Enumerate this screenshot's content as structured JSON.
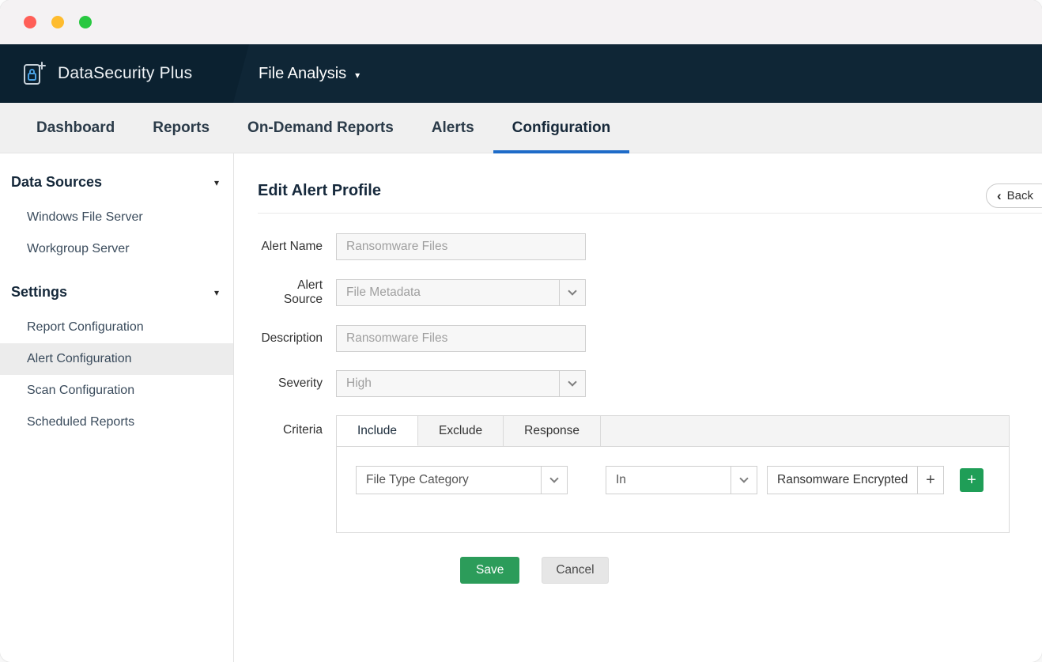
{
  "colors": {
    "header_navy": "#0f2636",
    "accent_blue": "#1e6bc8",
    "action_green": "#2c9c5a",
    "add_green": "#1f9e57",
    "nav_bg": "#f0f0f0",
    "active_item_bg": "#ececec"
  },
  "icons": {
    "module_caret": "▾",
    "section_caret": "▾",
    "back_chevron": "‹",
    "plus": "+"
  },
  "header": {
    "app_name": "DataSecurity Plus",
    "module": "File Analysis"
  },
  "nav": {
    "items": [
      {
        "label": "Dashboard",
        "active": false
      },
      {
        "label": "Reports",
        "active": false
      },
      {
        "label": "On-Demand Reports",
        "active": false
      },
      {
        "label": "Alerts",
        "active": false
      },
      {
        "label": "Configuration",
        "active": true
      }
    ]
  },
  "sidebar": {
    "sections": [
      {
        "title": "Data Sources",
        "items": [
          {
            "label": "Windows File Server",
            "active": false
          },
          {
            "label": "Workgroup Server",
            "active": false
          }
        ]
      },
      {
        "title": "Settings",
        "items": [
          {
            "label": "Report Configuration",
            "active": false
          },
          {
            "label": "Alert Configuration",
            "active": true
          },
          {
            "label": "Scan Configuration",
            "active": false
          },
          {
            "label": "Scheduled Reports",
            "active": false
          }
        ]
      }
    ]
  },
  "main": {
    "title": "Edit Alert Profile",
    "back_label": "Back",
    "form": {
      "alert_name": {
        "label": "Alert Name",
        "value": "Ransomware Files"
      },
      "alert_source": {
        "label": "Alert Source",
        "value": "File Metadata"
      },
      "description": {
        "label": "Description",
        "value": "Ransomware Files"
      },
      "severity": {
        "label": "Severity",
        "value": "High"
      },
      "criteria": {
        "label": "Criteria",
        "tabs": [
          {
            "label": "Include",
            "active": true
          },
          {
            "label": "Exclude",
            "active": false
          },
          {
            "label": "Response",
            "active": false
          }
        ],
        "row": {
          "field": "File Type Category",
          "operator": "In",
          "value": "Ransomware Encrypted"
        }
      },
      "save_label": "Save",
      "cancel_label": "Cancel"
    }
  }
}
